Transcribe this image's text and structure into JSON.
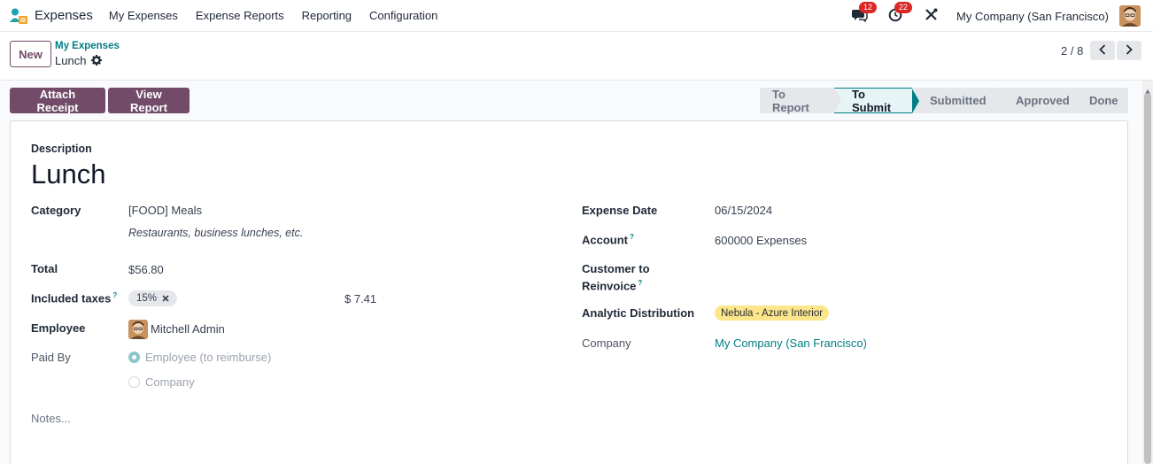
{
  "nav": {
    "app_name": "Expenses",
    "menu": [
      "My Expenses",
      "Expense Reports",
      "Reporting",
      "Configuration"
    ],
    "messages_count": "12",
    "activities_count": "22",
    "company": "My Company (San Francisco)",
    "icons": [
      "expenses-app-icon",
      "messages-icon",
      "activity-clock-icon",
      "debug-tools-icon",
      "user-avatar"
    ]
  },
  "control_panel": {
    "new_label": "New",
    "breadcrumb_parent": "My Expenses",
    "breadcrumb_current": "Lunch",
    "pager": "2 / 8"
  },
  "actions": {
    "attach_receipt": "Attach Receipt",
    "view_report": "View Report"
  },
  "status_stages": [
    "To Report",
    "To Submit",
    "Submitted",
    "Approved",
    "Done"
  ],
  "status_active": "To Submit",
  "form": {
    "description_label": "Description",
    "title": "Lunch",
    "category_label": "Category",
    "category_value": "[FOOD] Meals",
    "category_hint": "Restaurants, business lunches, etc.",
    "total_label": "Total",
    "total_value": "$56.80",
    "taxes_label": "Included taxes",
    "tax_tag": "15%",
    "tax_amount": "$ 7.41",
    "employee_label": "Employee",
    "employee_value": "Mitchell Admin",
    "paid_by_label": "Paid By",
    "paid_by_options": [
      "Employee (to reimburse)",
      "Company"
    ],
    "paid_by_selected": "Employee (to reimburse)",
    "notes_placeholder": "Notes...",
    "expense_date_label": "Expense Date",
    "expense_date_value": "06/15/2024",
    "account_label": "Account",
    "account_value": "600000 Expenses",
    "customer_label_1": "Customer to",
    "customer_label_2": "Reinvoice",
    "analytic_label": "Analytic Distribution",
    "analytic_tag": "Nebula - Azure Interior",
    "company_label": "Company",
    "company_value": "My Company (San Francisco)",
    "help_marker": "?"
  },
  "colors": {
    "primary": "#714b67",
    "link": "#017e84",
    "badge": "#dc2626",
    "analytic_tag": "#fde68a"
  }
}
